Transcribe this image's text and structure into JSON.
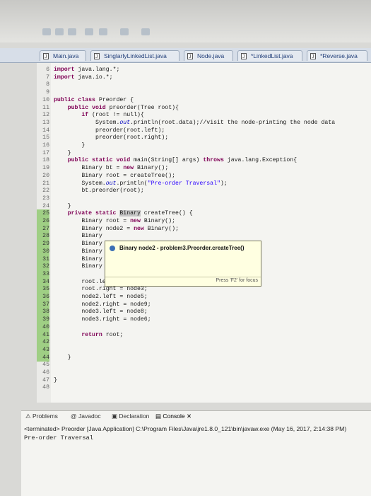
{
  "tabs": [
    {
      "label": "Main.java",
      "active": false
    },
    {
      "label": "SinglarlyLinkedList.java",
      "active": false
    },
    {
      "label": "Node.java",
      "active": false
    },
    {
      "label": "*LinkedList.java",
      "active": false
    },
    {
      "label": "*Reverse.java",
      "active": false
    }
  ],
  "code_lines": [
    {
      "n": "6",
      "t": "import java.lang.*;"
    },
    {
      "n": "7",
      "t": "import java.io.*;"
    },
    {
      "n": "8",
      "t": ""
    },
    {
      "n": "9",
      "t": ""
    },
    {
      "n": "10",
      "t": "public class Preorder {"
    },
    {
      "n": "11",
      "t": "    public void preorder(Tree root){"
    },
    {
      "n": "12",
      "t": "        if (root != null){"
    },
    {
      "n": "13",
      "t": "            System.out.println(root.data);//visit the node-printing the node data"
    },
    {
      "n": "14",
      "t": "            preorder(root.left);"
    },
    {
      "n": "15",
      "t": "            preorder(root.right);"
    },
    {
      "n": "16",
      "t": "        }"
    },
    {
      "n": "17",
      "t": "    }"
    },
    {
      "n": "18",
      "t": "    public static void main(String[] args) throws java.lang.Exception{"
    },
    {
      "n": "19",
      "t": "        Binary bt = new Binary();"
    },
    {
      "n": "20",
      "t": "        Binary root = createTree();"
    },
    {
      "n": "21",
      "t": "        System.out.println(\"Pre-order Traversal\");"
    },
    {
      "n": "22",
      "t": "        bt.preorder(root);"
    },
    {
      "n": "23",
      "t": ""
    },
    {
      "n": "24",
      "t": "    }"
    },
    {
      "n": "25",
      "t": "    private static Binary createTree() {"
    },
    {
      "n": "26",
      "t": "        Binary root = new Binary();"
    },
    {
      "n": "27",
      "t": "        Binary node2 = new Binary();"
    },
    {
      "n": "28",
      "t": "        Binary"
    },
    {
      "n": "29",
      "t": "        Binary"
    },
    {
      "n": "30",
      "t": "        Binary"
    },
    {
      "n": "31",
      "t": "        Binary"
    },
    {
      "n": "32",
      "t": "        Binary"
    },
    {
      "n": "33",
      "t": ""
    },
    {
      "n": "34",
      "t": "        root.left = node2;"
    },
    {
      "n": "35",
      "t": "        root.right = node3;"
    },
    {
      "n": "36",
      "t": "        node2.left = node5;"
    },
    {
      "n": "37",
      "t": "        node2.right = node9;"
    },
    {
      "n": "38",
      "t": "        node3.left = node8;"
    },
    {
      "n": "39",
      "t": "        node3.right = node6;"
    },
    {
      "n": "40",
      "t": ""
    },
    {
      "n": "41",
      "t": "        return root;"
    },
    {
      "n": "42",
      "t": ""
    },
    {
      "n": "43",
      "t": ""
    },
    {
      "n": "44",
      "t": "    }"
    },
    {
      "n": "45",
      "t": ""
    },
    {
      "n": "46",
      "t": ""
    },
    {
      "n": "47",
      "t": "}"
    },
    {
      "n": "48",
      "t": ""
    }
  ],
  "popup": {
    "text": "Binary node2 - problem3.Preorder.createTree()",
    "hint": "Press 'F2' for focus"
  },
  "panel": {
    "tabs": [
      {
        "label": "Problems",
        "active": false
      },
      {
        "label": "Javadoc",
        "active": false
      },
      {
        "label": "Declaration",
        "active": false
      },
      {
        "label": "Console",
        "active": true
      }
    ],
    "terminated_line": "<terminated> Preorder [Java Application] C:\\Program Files\\Java\\jre1.8.0_121\\bin\\javaw.exe (May 16, 2017, 2:14:38 PM)",
    "output": "Pre-order Traversal"
  },
  "colors": {
    "keyword": "#7f0055",
    "string": "#2a00ff",
    "field": "#0000c0",
    "marker": "#9fcf84"
  }
}
